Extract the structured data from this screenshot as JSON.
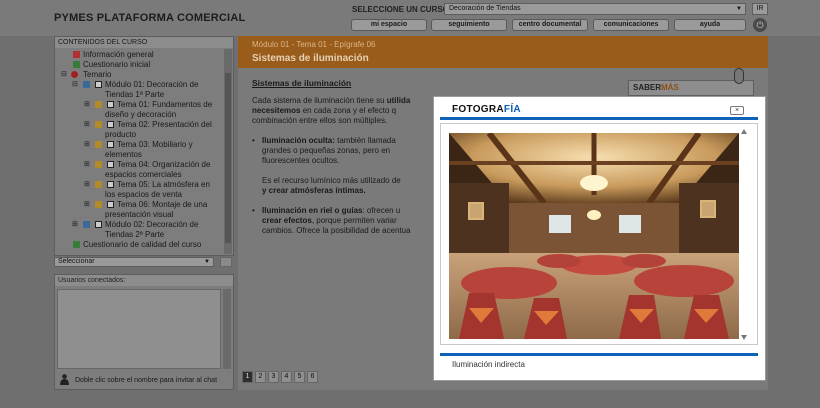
{
  "header": {
    "app_title": "PYMES PLATAFORMA COMERCIAL",
    "select_label": "SELECCIONE UN CURSO:",
    "course_selected": "Decoración de Tiendas",
    "go_label": "IR",
    "nav": [
      "mi espacio",
      "seguimiento",
      "centro documental",
      "comunicaciones",
      "ayuda"
    ],
    "power_icon": "power-icon"
  },
  "sidebar": {
    "title": "CONTENIDOS DEL CURSO",
    "items": [
      {
        "label": "Información general"
      },
      {
        "label": "Cuestionario inicial"
      },
      {
        "label": "Temario"
      },
      {
        "label": "Módulo 01: Decoración de"
      },
      {
        "label": "Tiendas 1ª Parte"
      },
      {
        "label": "Tema 01: Fundamentos de"
      },
      {
        "label": "diseño y decoración"
      },
      {
        "label": "Tema 02: Presentación del"
      },
      {
        "label": "producto"
      },
      {
        "label": "Tema 03: Mobiliario y"
      },
      {
        "label": "elementos"
      },
      {
        "label": "Tema 04: Organización de"
      },
      {
        "label": "espacios comerciales"
      },
      {
        "label": "Tema 05: La atmósfera en"
      },
      {
        "label": "los espacios de venta"
      },
      {
        "label": "Tema 06: Montaje de una"
      },
      {
        "label": "presentación visual"
      },
      {
        "label": "Módulo 02: Decoración de"
      },
      {
        "label": "Tiendas 2ª Parte"
      },
      {
        "label": "Cuestionario de calidad del curso"
      }
    ],
    "select_placeholder": "Seleccionar"
  },
  "users": {
    "title": "Usuarios conectados:",
    "hint": "Doble clic sobre el nombre para invitar al chat"
  },
  "content": {
    "breadcrumb": "Módulo 01 - Tema 01 - Epígrafe 06",
    "title": "Sistemas de iluminación",
    "heading": "Sistemas de iluminación",
    "para1_a": "Cada sistema de iluminación tiene su ",
    "para1_b": "utilida",
    "para1_c": "necesitemos",
    "para1_d": " en cada zona y el efecto q",
    "para1_e": "combinación entre ellos son múltiples.",
    "b1_a": "Iluminación oculta:",
    "b1_b": " también llamada",
    "b1_c": "grandes o pequeñas zonas, pero en",
    "b1_d": "fluorescentes ocultos.",
    "p2_a": "Es el recurso lumínico más utilizado de",
    "p2_b": "y crear atmósferas íntimas.",
    "b2_a": "Iluminación en riel o guías",
    "b2_b": ": ofrecen u",
    "b2_c": "crear efectos",
    "b2_d": ", porque permiten variar",
    "b2_e": "cambios. Ofrece la posibilidad de acentua",
    "saber_a": "SABER",
    "saber_b": "MÁS",
    "pages": [
      "1",
      "2",
      "3",
      "4",
      "5",
      "6"
    ]
  },
  "modal": {
    "title_a": "FOTOGRA",
    "title_b": "FÍA",
    "close": "×",
    "caption": "Iluminación indirecta"
  },
  "colors": {
    "accent_orange": "#9a5c1a",
    "modal_blue": "#0e63b8"
  }
}
